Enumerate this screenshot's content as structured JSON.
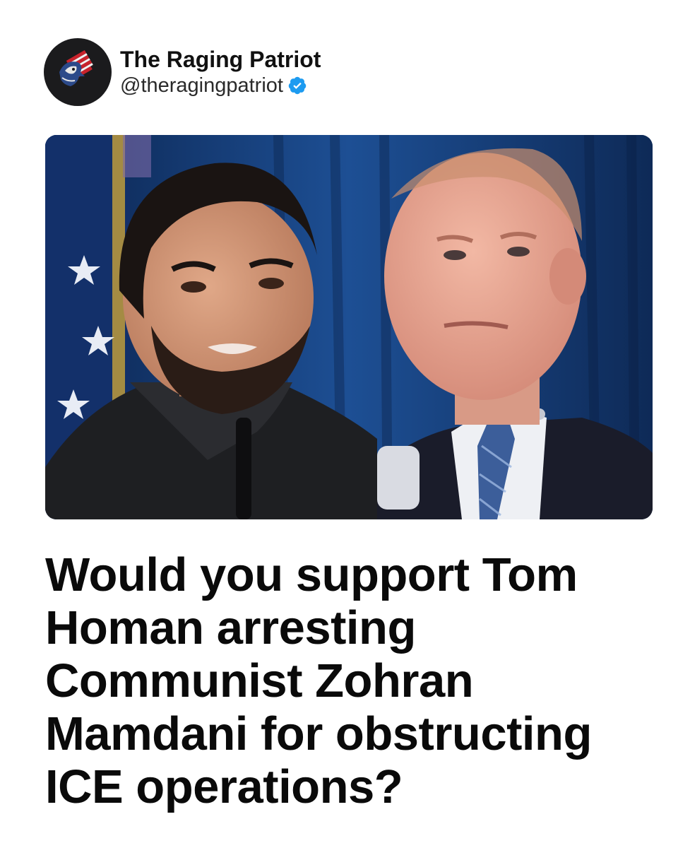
{
  "account": {
    "display_name": "The Raging Patriot",
    "handle": "@theragingpatriot",
    "verified": true,
    "avatar_icon": "patriot-logo-icon",
    "verified_icon": "verified-badge-icon"
  },
  "colors": {
    "verified_blue": "#1d9bf0",
    "text": "#0a0a0a",
    "photo_backdrop": "#0d2f5e"
  },
  "photo": {
    "subjects": [
      "left-portrait",
      "right-portrait"
    ]
  },
  "headline": "Would you support Tom Homan arresting Communist Zohran Mamdani for obstructing ICE operations?"
}
